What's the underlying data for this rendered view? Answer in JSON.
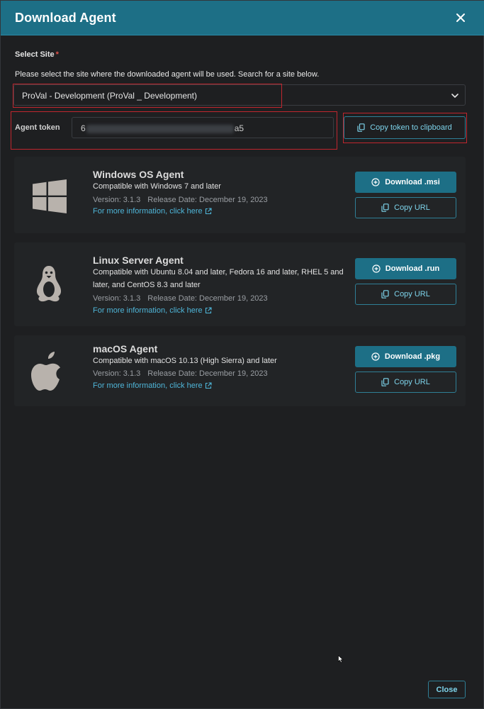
{
  "dialog": {
    "title": "Download Agent",
    "close_label": "Close"
  },
  "site": {
    "label": "Select Site",
    "required_mark": "*",
    "help": "Please select the site where the downloaded agent will be used. Search for a site below.",
    "selected": "ProVal - Development (ProVal _ Development)"
  },
  "token": {
    "label": "Agent token",
    "value_start": "6",
    "value_end": "a5",
    "copy_label": "Copy token to clipboard"
  },
  "agents": [
    {
      "name": "Windows OS Agent",
      "compat": "Compatible with Windows 7 and later",
      "version": "Version: 3.1.3",
      "release": "Release Date: December 19, 2023",
      "more": "For more information, click here",
      "download": "Download .msi",
      "copy_url": "Copy URL",
      "icon": "windows-logo-icon"
    },
    {
      "name": "Linux Server Agent",
      "compat": "Compatible with Ubuntu 8.04 and later, Fedora 16 and later, RHEL 5 and later, and CentOS 8.3 and later",
      "version": "Version: 3.1.3",
      "release": "Release Date: December 19, 2023",
      "more": "For more information, click here",
      "download": "Download .run",
      "copy_url": "Copy URL",
      "icon": "linux-tux-icon"
    },
    {
      "name": "macOS Agent",
      "compat": "Compatible with macOS 10.13 (High Sierra) and later",
      "version": "Version: 3.1.3",
      "release": "Release Date: December 19, 2023",
      "more": "For more information, click here",
      "download": "Download .pkg",
      "copy_url": "Copy URL",
      "icon": "apple-logo-icon"
    }
  ],
  "colors": {
    "header": "#1d6f86",
    "accent": "#7dd3ea",
    "link": "#4fb6d9",
    "required": "#e0524a",
    "annotation": "#c0262e"
  }
}
